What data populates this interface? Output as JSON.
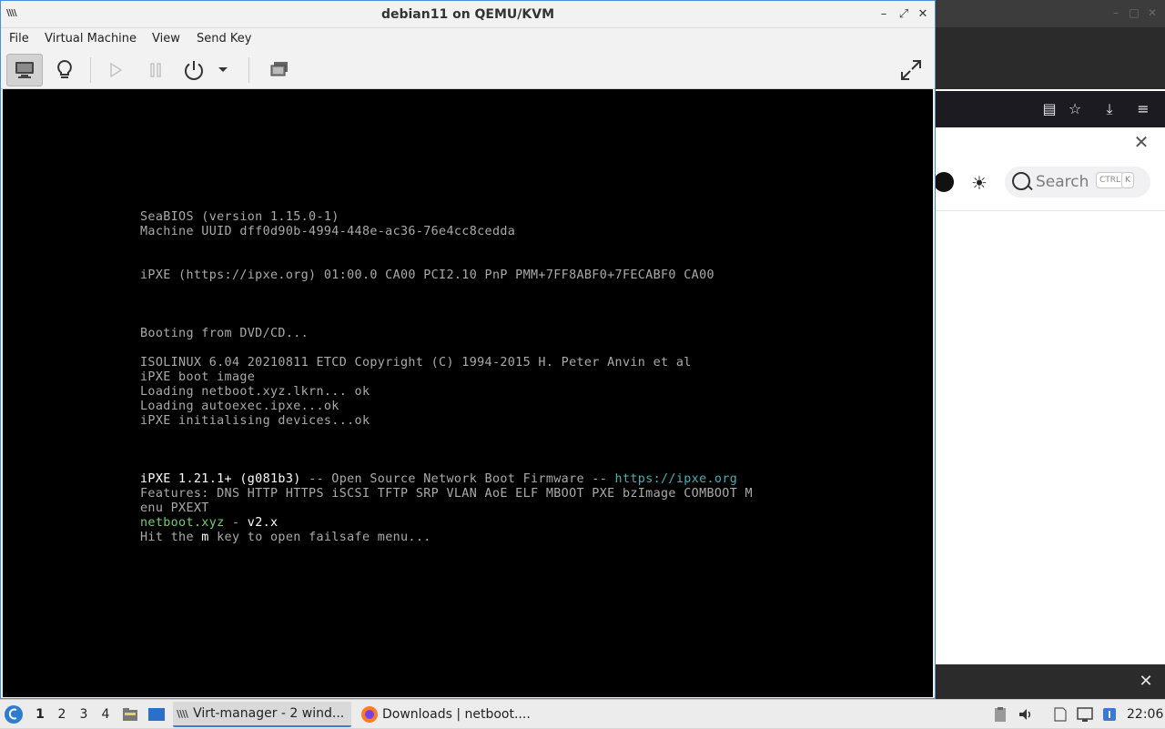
{
  "vm_window": {
    "title": "debian11 on QEMU/KVM",
    "menu": [
      "File",
      "Virtual Machine",
      "View",
      "Send Key"
    ],
    "toolbar_icons": [
      "display-icon",
      "lightbulb-icon",
      "play-icon",
      "pause-icon",
      "power-icon",
      "dropdown-icon",
      "snapshot-icon",
      "fullscreen-icon"
    ]
  },
  "console": {
    "lines": [
      "SeaBIOS (version 1.15.0-1)",
      "Machine UUID dff0d90b-4994-448e-ac36-76e4cc8cedda",
      "iPXE (https://ipxe.org) 01:00.0 CA00 PCI2.10 PnP PMM+7FF8ABF0+7FECABF0 CA00",
      "Booting from DVD/CD...",
      "ISOLINUX 6.04 20210811 ETCD Copyright (C) 1994-2015 H. Peter Anvin et al",
      "iPXE boot image",
      "Loading netboot.xyz.lkrn... ok",
      "Loading autoexec.ipxe...ok",
      "iPXE initialising devices...ok"
    ],
    "ipxe_banner": {
      "name": "iPXE 1.21.1+ (g081b3)",
      "middle": " -- Open Source Network Boot Firmware -- ",
      "url": "https://ipxe.org"
    },
    "features_line1": "Features: DNS HTTP HTTPS iSCSI TFTP SRP VLAN AoE ELF MBOOT PXE bzImage COMBOOT M",
    "features_line2": "enu PXEXT",
    "netboot": {
      "name": "netboot.xyz",
      "dash": " - ",
      "version": "v2.x"
    },
    "hint": {
      "before": "Hit the ",
      "key": "m",
      "after": " key to open failsafe menu..."
    }
  },
  "browser_bg": {
    "search_placeholder": "Search",
    "kbd_ctrl": "CTRL",
    "kbd_k": "K"
  },
  "taskbar": {
    "workspaces": [
      "1",
      "2",
      "3",
      "4"
    ],
    "tasks": [
      {
        "label": "Virt-manager - 2 wind..."
      },
      {
        "label": "Downloads | netboot...."
      }
    ],
    "clock": "22:06"
  }
}
